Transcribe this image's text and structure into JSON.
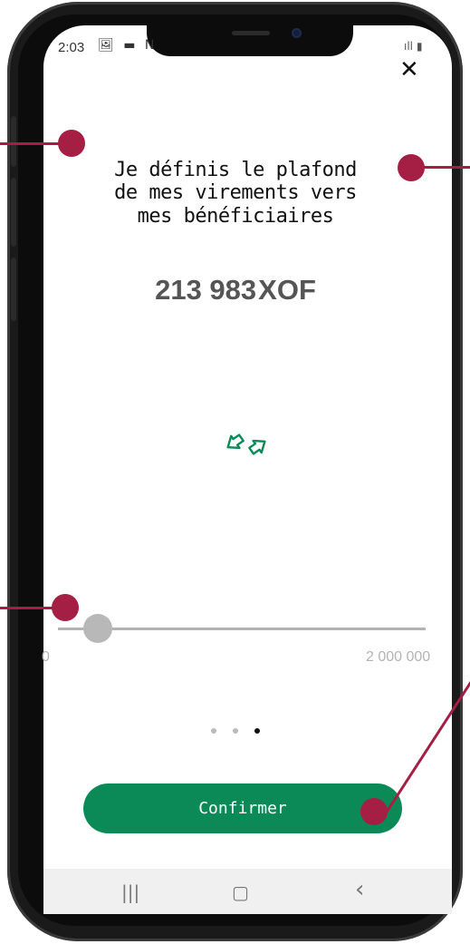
{
  "status_bar": {
    "time": "2:03",
    "left_icons": "🖼 ▬ N",
    "right_icons": "ıll ▮"
  },
  "title": "Je définis le plafond\nde mes virements vers\nmes bénéficiaires",
  "amount": {
    "value": "213 983",
    "currency": "XOF"
  },
  "slider": {
    "min_label": "0",
    "max_label": "2 000 000",
    "value": 213983,
    "min": 0,
    "max": 2000000
  },
  "pager": {
    "count": 3,
    "active_index": 2
  },
  "confirm_label": "Confirmer",
  "nav_bar": {
    "recent_icon": "|||",
    "home_icon": "▢",
    "back_icon": "‹"
  },
  "colors": {
    "accent": "#0b8a57",
    "annotation": "#a51f45",
    "slider_track": "#b3b3b3"
  }
}
